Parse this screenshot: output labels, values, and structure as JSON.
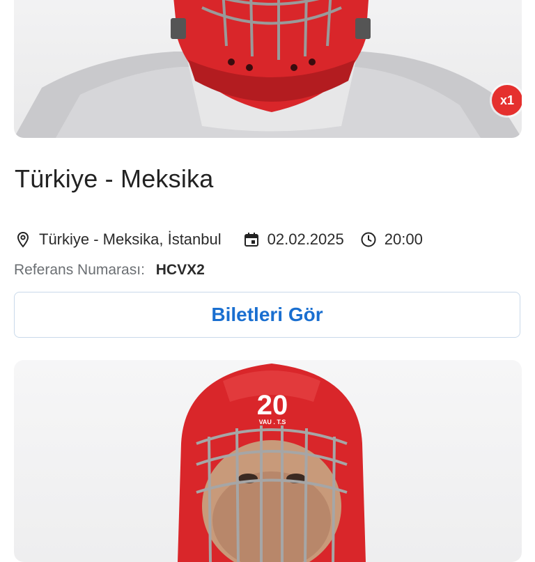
{
  "event": {
    "title": "Türkiye - Meksika",
    "venue": "Türkiye - Meksika, İstanbul",
    "date": "02.02.2025",
    "time": "20:00",
    "reference_label": "Referans Numarası:",
    "reference_value": "HCVX2",
    "quantity_badge": "x1"
  },
  "actions": {
    "view_tickets_label": "Biletleri Gör"
  },
  "next_card": {
    "jersey_number": "20"
  },
  "colors": {
    "accent_blue": "#1a6fd0",
    "badge_red": "#e5302e",
    "helmet_red": "#d9262a"
  },
  "icons": {
    "venue": "location-pin-icon",
    "date": "calendar-icon",
    "time": "clock-icon"
  }
}
